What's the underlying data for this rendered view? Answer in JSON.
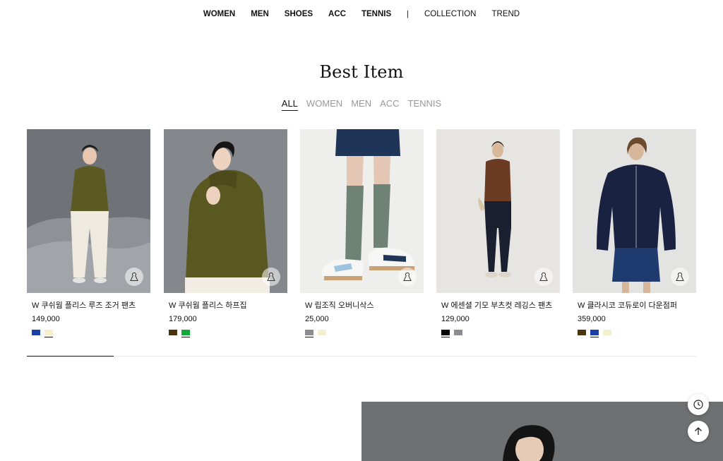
{
  "nav": {
    "items": [
      {
        "label": "WOMEN",
        "bold": true
      },
      {
        "label": "MEN",
        "bold": true
      },
      {
        "label": "SHOES",
        "bold": true
      },
      {
        "label": "ACC",
        "bold": true
      },
      {
        "label": "TENNIS",
        "bold": true
      }
    ],
    "separator": "|",
    "secondary": [
      {
        "label": "COLLECTION"
      },
      {
        "label": "TREND"
      }
    ]
  },
  "best": {
    "title": "Best Item",
    "tabs": [
      {
        "label": "ALL",
        "active": true
      },
      {
        "label": "WOMEN",
        "active": false
      },
      {
        "label": "MEN",
        "active": false
      },
      {
        "label": "ACC",
        "active": false
      },
      {
        "label": "TENNIS",
        "active": false
      }
    ],
    "products": [
      {
        "name": "W 쿠쉬웜 플리스 루즈 조거 팬츠",
        "price": "149,000",
        "swatches": [
          "#1c3fa8",
          "#f3efcf"
        ],
        "selected": 1,
        "photo": "model-olive-fleece-white-pants"
      },
      {
        "name": "W 쿠쉬웜 플리스 하프집",
        "price": "179,000",
        "swatches": [
          "#4a3410",
          "#14a83c"
        ],
        "selected": 1,
        "photo": "model-olive-fleece-halfzip"
      },
      {
        "name": "W 립조직 오버니삭스",
        "price": "25,000",
        "swatches": [
          "#8a8d90",
          "#f3efcf"
        ],
        "selected": 0,
        "photo": "legs-green-knee-socks-sneakers"
      },
      {
        "name": "W 에센셜 기모 부츠컷 레깅스 팬츠",
        "price": "129,000",
        "swatches": [
          "#000000",
          "#8a8d90"
        ],
        "selected": 0,
        "photo": "model-brown-top-bootcut-leggings"
      },
      {
        "name": "W 클라시코 코듀로이 다운점퍼",
        "price": "359,000",
        "swatches": [
          "#4a3410",
          "#1c3fa8",
          "#f3efcf"
        ],
        "selected": 1,
        "photo": "model-navy-corduroy-down-jacket"
      }
    ]
  },
  "carousel": {
    "progress": 0.13
  },
  "floating": {
    "recent_icon": "clock-icon",
    "top_icon": "arrow-up-icon"
  }
}
